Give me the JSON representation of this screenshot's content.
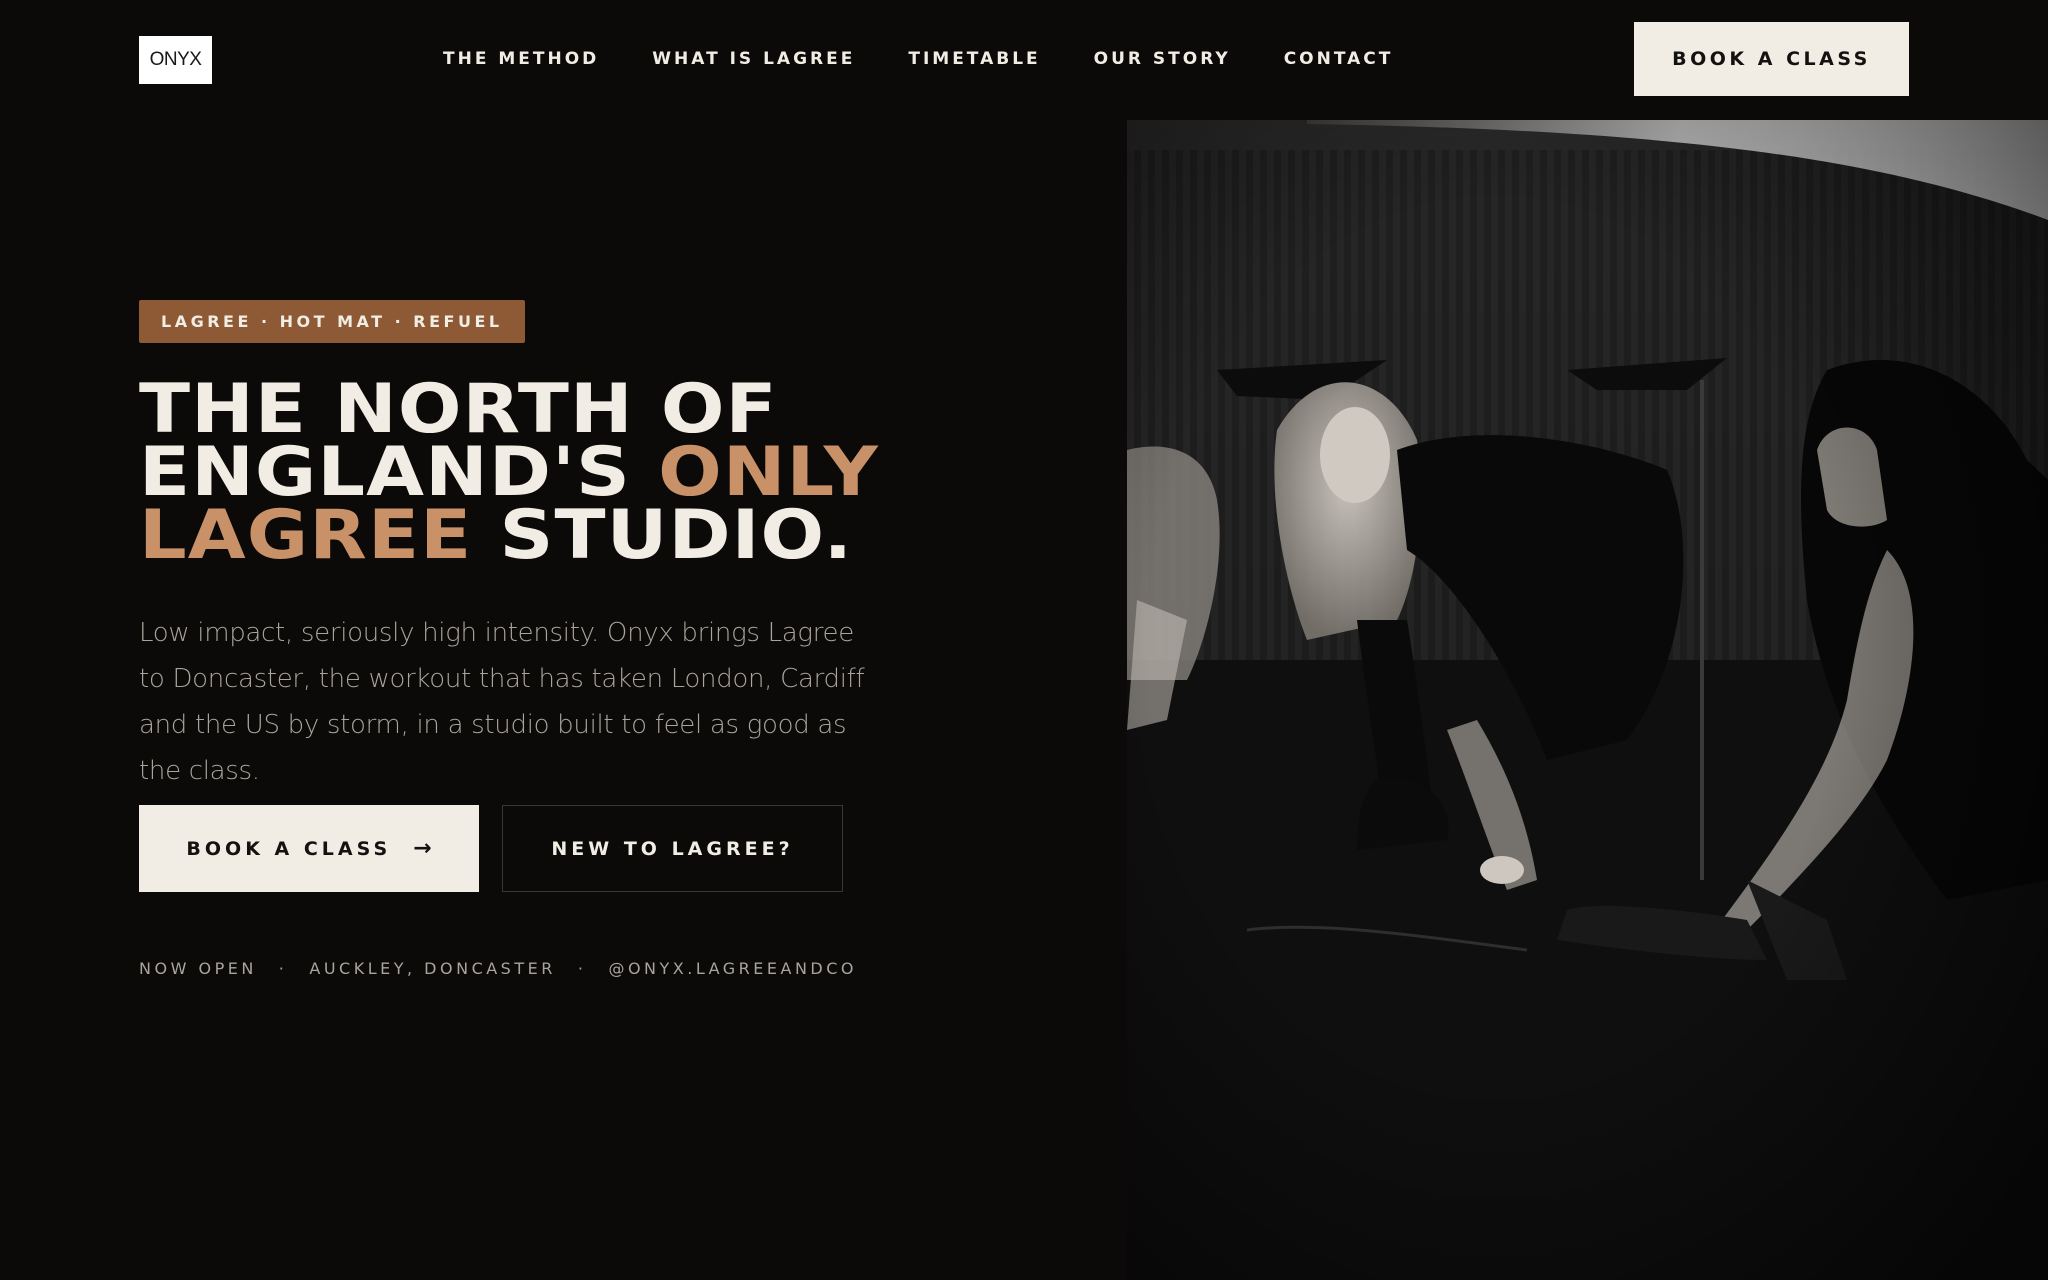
{
  "brand": {
    "logo_text": "ONYX"
  },
  "nav": {
    "items": [
      {
        "label": "THE METHOD"
      },
      {
        "label": "WHAT IS LAGREE"
      },
      {
        "label": "TIMETABLE"
      },
      {
        "label": "OUR STORY"
      },
      {
        "label": "CONTACT"
      }
    ],
    "cta_label": "BOOK A CLASS"
  },
  "hero": {
    "eyebrow": "LAGREE · HOT MAT · REFUEL",
    "headline": {
      "part1": "THE NORTH OF",
      "part2": "ENGLAND'S",
      "accent1": "ONLY",
      "accent2": "LAGREE",
      "part3": "STUDIO."
    },
    "subtitle": "Low impact, seriously high intensity. Onyx brings Lagree to Doncaster, the workout that has taken London, Cardiff and the US by storm, in a studio built to feel as good as the class.",
    "primary_button": "BOOK A CLASS",
    "secondary_button": "NEW TO LAGREE?",
    "info": {
      "status": "NOW OPEN",
      "location": "AUCKLEY, DONCASTER",
      "social": "@ONYX.LAGREEANDCO"
    }
  },
  "colors": {
    "background": "#0b0a09",
    "accent": "#c99168",
    "eyebrow_bg": "#8e5a36",
    "cream": "#f2ede4"
  },
  "icons": {
    "primary_button_icon": "arrow-right-icon"
  }
}
